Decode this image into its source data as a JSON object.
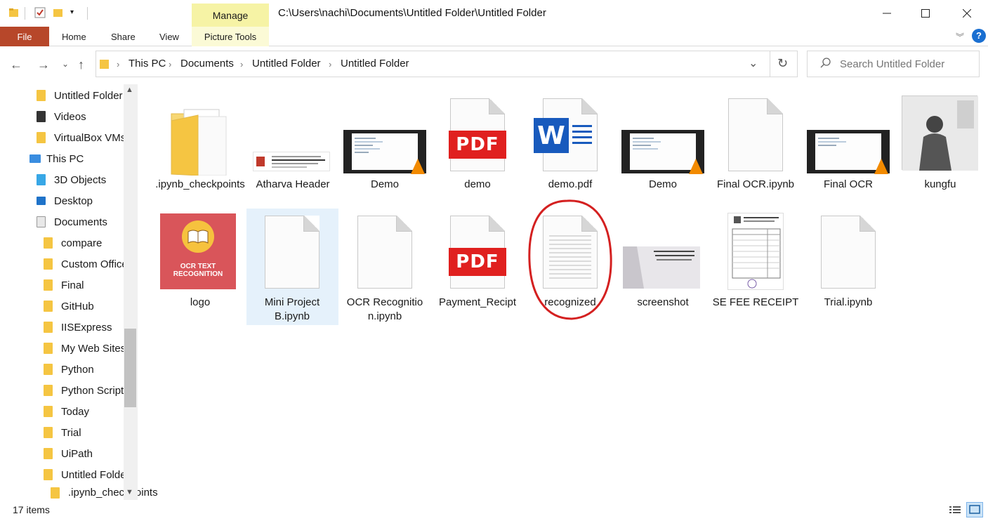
{
  "window": {
    "title_path": "C:\\Users\\nachi\\Documents\\Untitled Folder\\Untitled Folder",
    "contextual_tab": "Manage"
  },
  "ribbon": {
    "tabs": [
      "File",
      "Home",
      "Share",
      "View",
      "Picture Tools"
    ]
  },
  "breadcrumbs": [
    "This PC",
    "Documents",
    "Untitled Folder",
    "Untitled Folder"
  ],
  "search": {
    "placeholder": "Search Untitled Folder"
  },
  "sidebar": {
    "items": [
      {
        "label": "Untitled Folder",
        "icon": "folder-icon"
      },
      {
        "label": "Videos",
        "icon": "videos-icon"
      },
      {
        "label": "VirtualBox VMs",
        "icon": "folder-icon"
      },
      {
        "label": "This PC",
        "icon": "computer-icon"
      },
      {
        "label": "3D Objects",
        "icon": "3d-objects-icon"
      },
      {
        "label": "Desktop",
        "icon": "desktop-icon"
      },
      {
        "label": "Documents",
        "icon": "documents-icon"
      },
      {
        "label": "compare",
        "icon": "folder-icon"
      },
      {
        "label": "Custom Office",
        "icon": "folder-icon"
      },
      {
        "label": "Final",
        "icon": "folder-icon"
      },
      {
        "label": "GitHub",
        "icon": "folder-icon"
      },
      {
        "label": "IISExpress",
        "icon": "folder-icon"
      },
      {
        "label": "My Web Sites",
        "icon": "folder-icon"
      },
      {
        "label": "Python",
        "icon": "folder-icon"
      },
      {
        "label": "Python Scripts",
        "icon": "folder-icon"
      },
      {
        "label": "Today",
        "icon": "folder-icon"
      },
      {
        "label": "Trial",
        "icon": "folder-icon"
      },
      {
        "label": "UiPath",
        "icon": "folder-icon"
      },
      {
        "label": "Untitled Folder",
        "icon": "folder-icon"
      },
      {
        "label": ".ipynb_checkpoints",
        "icon": "folder-icon"
      }
    ]
  },
  "files": [
    {
      "name": ".ipynb_checkpoints",
      "kind": "folder"
    },
    {
      "name": "Atharva Header",
      "kind": "image"
    },
    {
      "name": "Demo",
      "kind": "video"
    },
    {
      "name": "demo",
      "kind": "pdf",
      "badge": "PDF"
    },
    {
      "name": "demo.pdf",
      "kind": "word",
      "badge": "W"
    },
    {
      "name": "Demo",
      "kind": "video"
    },
    {
      "name": "Final OCR.ipynb",
      "kind": "blank"
    },
    {
      "name": "Final OCR",
      "kind": "video"
    },
    {
      "name": "kungfu",
      "kind": "image"
    },
    {
      "name": "logo",
      "kind": "image",
      "image_text": "OCR TEXT RECOGNITION"
    },
    {
      "name": "Mini Project B.ipynb",
      "kind": "blank",
      "selected": true
    },
    {
      "name": "OCR Recognition.ipynb",
      "kind": "blank"
    },
    {
      "name": "Payment_Recipt",
      "kind": "pdf",
      "badge": "PDF"
    },
    {
      "name": "recognized",
      "kind": "text",
      "annotated": true
    },
    {
      "name": "screenshot",
      "kind": "image"
    },
    {
      "name": "SE FEE RECEIPT",
      "kind": "image"
    },
    {
      "name": "Trial.ipynb",
      "kind": "blank"
    }
  ],
  "status": {
    "item_count": "17 items"
  },
  "colors": {
    "file_tab": "#b7472a",
    "manage_tab": "#f6f3a5",
    "selection": "#e5f1fb",
    "annotation": "#d42020",
    "pdf": "#e0201f",
    "word": "#185abd"
  }
}
